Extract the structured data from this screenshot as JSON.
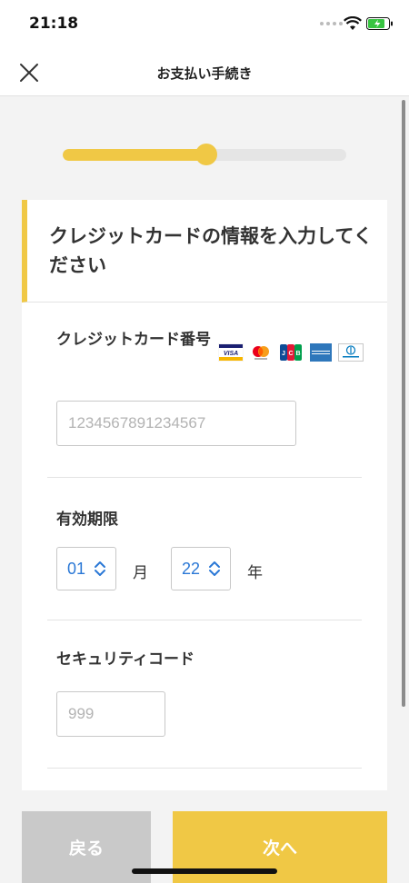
{
  "status_bar": {
    "time": "21:18"
  },
  "header": {
    "title": "お支払い手続き",
    "close_icon": "close-icon"
  },
  "progress": {
    "fraction": 0.505,
    "color": "#f0c845"
  },
  "card": {
    "title": "クレジットカードの情報を入力してください",
    "card_number": {
      "label": "クレジットカード番号",
      "placeholder": "1234567891234567",
      "brands": [
        "visa",
        "mastercard",
        "jcb",
        "american-express",
        "diners-club"
      ]
    },
    "expiry": {
      "label": "有効期限",
      "month_value": "01",
      "month_unit": "月",
      "year_value": "22",
      "year_unit": "年"
    },
    "security_code": {
      "label": "セキュリティコード",
      "placeholder": "999"
    }
  },
  "footer": {
    "back_label": "戻る",
    "next_label": "次へ"
  },
  "colors": {
    "accent": "#f0c845",
    "select_text": "#2a78d6",
    "back_button": "#c9c9c9"
  }
}
